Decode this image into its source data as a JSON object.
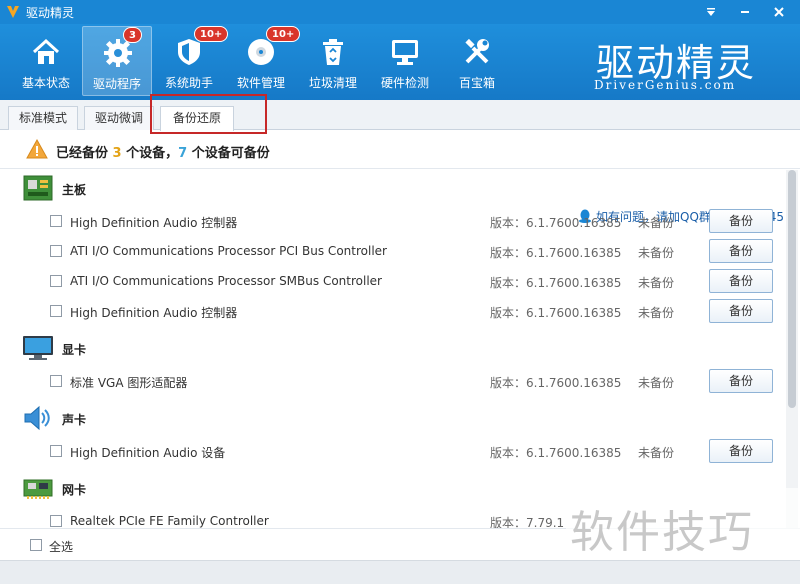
{
  "window": {
    "title": "驱动精灵",
    "controls": [
      "menu-dropdown",
      "minimize",
      "close"
    ]
  },
  "toolbar": {
    "items": [
      {
        "label": "基本状态",
        "icon": "home-icon"
      },
      {
        "label": "驱动程序",
        "icon": "gear-icon",
        "badge": "3",
        "active": true
      },
      {
        "label": "系统助手",
        "icon": "shield-icon",
        "badge": "10+"
      },
      {
        "label": "软件管理",
        "icon": "disc-icon",
        "badge": "10+"
      },
      {
        "label": "垃圾清理",
        "icon": "recycle-bin-icon"
      },
      {
        "label": "硬件检测",
        "icon": "monitor-icon"
      },
      {
        "label": "百宝箱",
        "icon": "tools-icon"
      }
    ],
    "brand_cn": "驱动精灵",
    "brand_en": "DriverGenius.com"
  },
  "tabs": [
    {
      "label": "标准模式"
    },
    {
      "label": "驱动微调"
    },
    {
      "label": "备份还原",
      "active": true
    }
  ],
  "help_text": "如有问题，请加QQ群：45151345",
  "summary": {
    "prefix": "已经备份",
    "backed_up": "3",
    "middle": "个设备，",
    "can_backup": "7",
    "suffix": "个设备可备份"
  },
  "categories": [
    {
      "name": "主板",
      "icon": "motherboard-icon",
      "devices": [
        {
          "name": "High Definition Audio 控制器",
          "version": "版本：6.1.7600.16385",
          "status": "未备份",
          "button": "备份"
        },
        {
          "name": "ATI I/O Communications Processor PCI Bus Controller",
          "version": "版本：6.1.7600.16385",
          "status": "未备份",
          "button": "备份"
        },
        {
          "name": "ATI I/O Communications Processor SMBus Controller",
          "version": "版本：6.1.7600.16385",
          "status": "未备份",
          "button": "备份"
        },
        {
          "name": "High Definition Audio 控制器",
          "version": "版本：6.1.7600.16385",
          "status": "未备份",
          "button": "备份"
        }
      ]
    },
    {
      "name": "显卡",
      "icon": "monitor-icon",
      "devices": [
        {
          "name": "标准 VGA 图形适配器",
          "version": "版本：6.1.7600.16385",
          "status": "未备份",
          "button": "备份"
        }
      ]
    },
    {
      "name": "声卡",
      "icon": "speaker-icon",
      "devices": [
        {
          "name": "High Definition Audio 设备",
          "version": "版本：6.1.7600.16385",
          "status": "未备份",
          "button": "备份"
        }
      ]
    },
    {
      "name": "网卡",
      "icon": "network-card-icon",
      "devices": [
        {
          "name": "Realtek PCIe FE Family Controller",
          "version": "版本：7.79.1",
          "status": "",
          "button": ""
        }
      ]
    }
  ],
  "footer": {
    "select_all": "全选"
  },
  "watermark": "软件技巧",
  "colors": {
    "primary_blue": "#1a86d4",
    "badge_red": "#d9352a",
    "highlight_red": "#c62828",
    "count_yellow": "#e3a317",
    "count_cyan": "#3aa3d8"
  }
}
